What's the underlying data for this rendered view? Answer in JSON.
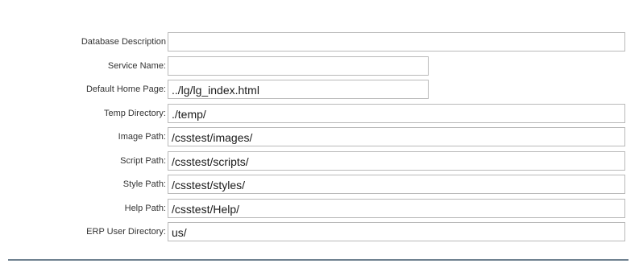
{
  "form": {
    "fields": [
      {
        "label": "Database Description",
        "value": ""
      },
      {
        "label": "Service Name:",
        "value": ""
      },
      {
        "label": "Default Home Page:",
        "value": "../lg/lg_index.html"
      },
      {
        "label": "Temp Directory:",
        "value": "./temp/"
      },
      {
        "label": "Image Path:",
        "value": "/csstest/images/"
      },
      {
        "label": "Script Path:",
        "value": "/csstest/scripts/"
      },
      {
        "label": "Style Path:",
        "value": "/csstest/styles/"
      },
      {
        "label": "Help Path:",
        "value": "/csstest/Help/"
      },
      {
        "label": "ERP User Directory:",
        "value": "us/"
      }
    ]
  }
}
